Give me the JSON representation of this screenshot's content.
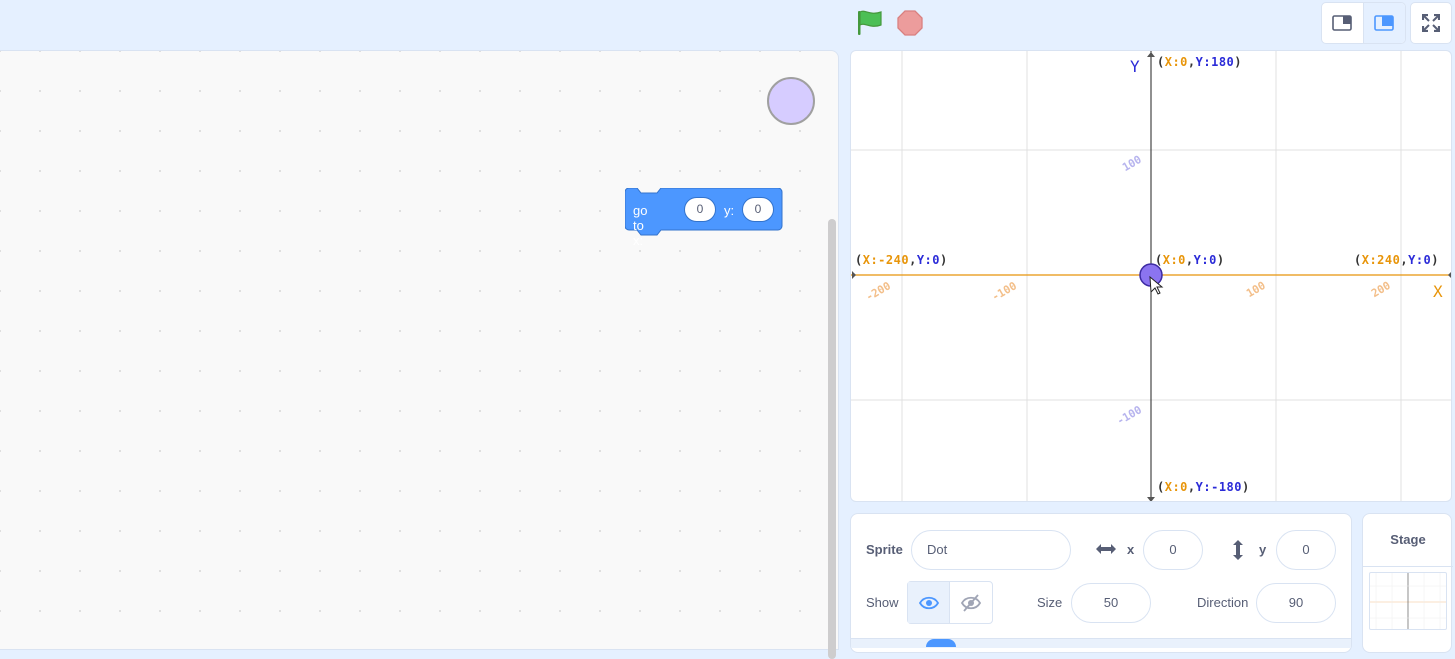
{
  "toolbar": {
    "green_flag_icon": "green-flag-icon",
    "stop_icon": "stop-icon",
    "small_stage_icon": "small-stage-layout-icon",
    "normal_stage_icon": "normal-stage-layout-icon",
    "fullscreen_icon": "fullscreen-icon"
  },
  "code_area": {
    "block": {
      "label_go_to_x": "go to x:",
      "x_value": "0",
      "label_y": "y:",
      "y_value": "0",
      "color": "#4c97ff"
    }
  },
  "stage": {
    "y_axis_letter": "Y",
    "x_axis_letter": "X",
    "top_label": {
      "open": "(",
      "x": "X:0",
      "comma": ",",
      "y": "Y:180",
      "close": ")"
    },
    "bottom_label": {
      "open": "(",
      "x": "X:0",
      "comma": ",",
      "y": "Y:-180",
      "close": ")"
    },
    "left_label": {
      "open": "(",
      "x": "X:-240",
      "comma": ",",
      "y": "Y:0",
      "close": ")"
    },
    "right_label": {
      "open": "(",
      "x": "X:240",
      "comma": ",",
      "y": "Y:0",
      "close": ")"
    },
    "center_label": {
      "open": "(",
      "x": "X:0",
      "comma": ",",
      "y": "Y:0",
      "close": ")"
    },
    "x_ticks": [
      "-200",
      "-100",
      "100",
      "200"
    ],
    "y_ticks": [
      "100",
      "-100"
    ],
    "colors": {
      "x_axis": "#e8950a",
      "y_axis": "#2b2bd8",
      "dot": "#8b74f0"
    }
  },
  "sprite_info": {
    "sprite_label": "Sprite",
    "sprite_name": "Dot",
    "x_label": "x",
    "x_value": "0",
    "y_label": "y",
    "y_value": "0",
    "show_label": "Show",
    "size_label": "Size",
    "size_value": "50",
    "direction_label": "Direction",
    "direction_value": "90"
  },
  "stage_panel": {
    "title": "Stage"
  }
}
